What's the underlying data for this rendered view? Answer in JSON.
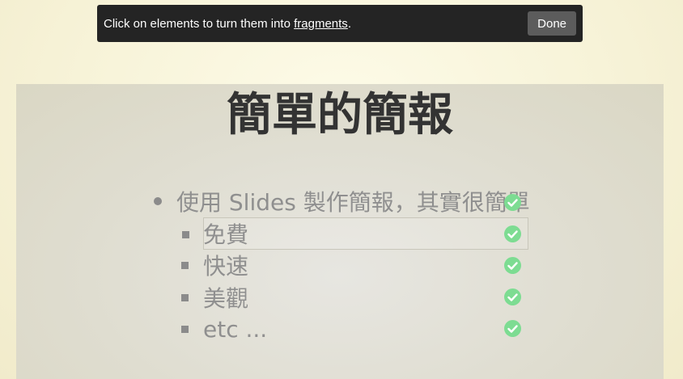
{
  "toolbar": {
    "prefix": "Click on elements to turn them into ",
    "link": "fragments",
    "suffix": ".",
    "done_label": "Done"
  },
  "slide": {
    "title": "簡單的簡報",
    "bullet": "使用 Slides 製作簡報，其實很簡單",
    "sub_items": [
      "免費",
      "快速",
      "美觀",
      "etc ..."
    ]
  },
  "colors": {
    "toolbar_bg": "#242424",
    "fragment_check": "#7ddc92",
    "slide_bg": "#e2e0d6",
    "page_bg": "#f7f3d8"
  }
}
